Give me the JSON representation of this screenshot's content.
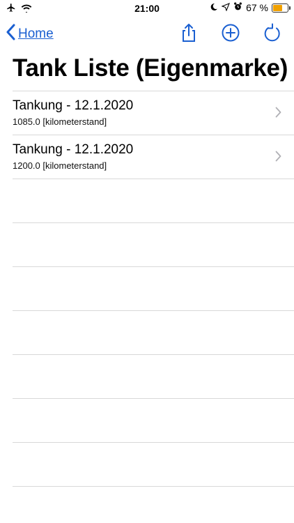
{
  "status": {
    "time": "21:00",
    "battery_text": "67 %",
    "battery_level": 0.67
  },
  "nav": {
    "back_label": "Home"
  },
  "page": {
    "title": "Tank Liste (Eigenmarke)"
  },
  "items": [
    {
      "title": "Tankung - 12.1.2020",
      "subtitle": "1085.0 [kilometerstand]"
    },
    {
      "title": "Tankung - 12.1.2020",
      "subtitle": "1200.0 [kilometerstand]"
    }
  ],
  "colors": {
    "accent": "#1a5fd1",
    "separator": "#d8d8d8",
    "battery": "#f0a000"
  },
  "icons": [
    "airplane-icon",
    "wifi-icon",
    "moon-icon",
    "location-icon",
    "alarm-icon",
    "battery-icon",
    "chevron-left-icon",
    "share-icon",
    "plus-circle-icon",
    "refresh-icon",
    "chevron-right-icon"
  ]
}
